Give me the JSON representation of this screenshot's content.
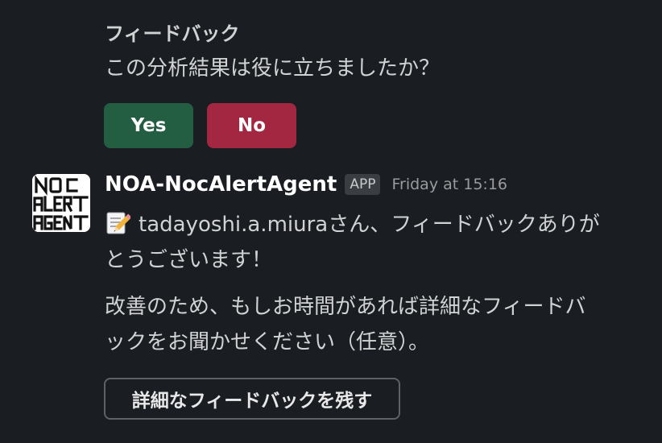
{
  "feedback_block": {
    "title": "フィードバック",
    "question": "この分析結果は役に立ちましたか？",
    "yes_label": "Yes",
    "no_label": "No",
    "colors": {
      "yes": "#235e43",
      "no": "#a42741"
    }
  },
  "message": {
    "sender": "NOA-NocAlertAgent",
    "badge": "APP",
    "timestamp": "Friday at 15:16",
    "avatar_icon": "noc-alert-agent-logo",
    "emoji_icon": "memo-pencil-icon",
    "line1": "tadayoshi.a.miuraさん、フィードバックありが",
    "line2": "とうございます！",
    "para2_line1": "改善のため、もしお時間があれば詳細なフィードバ",
    "para2_line2": "ックをお聞かせください（任意）。",
    "detail_button_label": "詳細なフィードバックを残す"
  }
}
